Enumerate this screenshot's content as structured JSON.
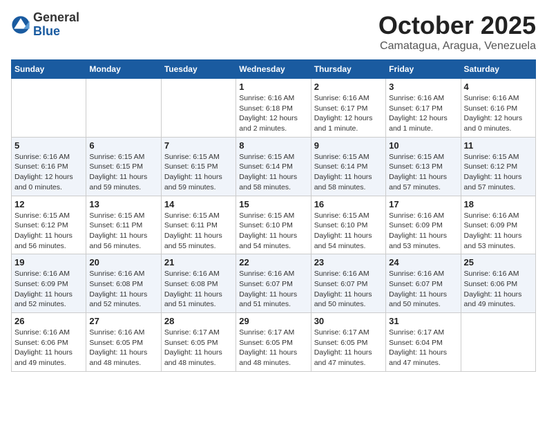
{
  "logo": {
    "general": "General",
    "blue": "Blue"
  },
  "title": "October 2025",
  "location": "Camatagua, Aragua, Venezuela",
  "days_header": [
    "Sunday",
    "Monday",
    "Tuesday",
    "Wednesday",
    "Thursday",
    "Friday",
    "Saturday"
  ],
  "weeks": [
    [
      {
        "day": "",
        "info": ""
      },
      {
        "day": "",
        "info": ""
      },
      {
        "day": "",
        "info": ""
      },
      {
        "day": "1",
        "info": "Sunrise: 6:16 AM\nSunset: 6:18 PM\nDaylight: 12 hours\nand 2 minutes."
      },
      {
        "day": "2",
        "info": "Sunrise: 6:16 AM\nSunset: 6:17 PM\nDaylight: 12 hours\nand 1 minute."
      },
      {
        "day": "3",
        "info": "Sunrise: 6:16 AM\nSunset: 6:17 PM\nDaylight: 12 hours\nand 1 minute."
      },
      {
        "day": "4",
        "info": "Sunrise: 6:16 AM\nSunset: 6:16 PM\nDaylight: 12 hours\nand 0 minutes."
      }
    ],
    [
      {
        "day": "5",
        "info": "Sunrise: 6:16 AM\nSunset: 6:16 PM\nDaylight: 12 hours\nand 0 minutes."
      },
      {
        "day": "6",
        "info": "Sunrise: 6:15 AM\nSunset: 6:15 PM\nDaylight: 11 hours\nand 59 minutes."
      },
      {
        "day": "7",
        "info": "Sunrise: 6:15 AM\nSunset: 6:15 PM\nDaylight: 11 hours\nand 59 minutes."
      },
      {
        "day": "8",
        "info": "Sunrise: 6:15 AM\nSunset: 6:14 PM\nDaylight: 11 hours\nand 58 minutes."
      },
      {
        "day": "9",
        "info": "Sunrise: 6:15 AM\nSunset: 6:14 PM\nDaylight: 11 hours\nand 58 minutes."
      },
      {
        "day": "10",
        "info": "Sunrise: 6:15 AM\nSunset: 6:13 PM\nDaylight: 11 hours\nand 57 minutes."
      },
      {
        "day": "11",
        "info": "Sunrise: 6:15 AM\nSunset: 6:12 PM\nDaylight: 11 hours\nand 57 minutes."
      }
    ],
    [
      {
        "day": "12",
        "info": "Sunrise: 6:15 AM\nSunset: 6:12 PM\nDaylight: 11 hours\nand 56 minutes."
      },
      {
        "day": "13",
        "info": "Sunrise: 6:15 AM\nSunset: 6:11 PM\nDaylight: 11 hours\nand 56 minutes."
      },
      {
        "day": "14",
        "info": "Sunrise: 6:15 AM\nSunset: 6:11 PM\nDaylight: 11 hours\nand 55 minutes."
      },
      {
        "day": "15",
        "info": "Sunrise: 6:15 AM\nSunset: 6:10 PM\nDaylight: 11 hours\nand 54 minutes."
      },
      {
        "day": "16",
        "info": "Sunrise: 6:15 AM\nSunset: 6:10 PM\nDaylight: 11 hours\nand 54 minutes."
      },
      {
        "day": "17",
        "info": "Sunrise: 6:16 AM\nSunset: 6:09 PM\nDaylight: 11 hours\nand 53 minutes."
      },
      {
        "day": "18",
        "info": "Sunrise: 6:16 AM\nSunset: 6:09 PM\nDaylight: 11 hours\nand 53 minutes."
      }
    ],
    [
      {
        "day": "19",
        "info": "Sunrise: 6:16 AM\nSunset: 6:09 PM\nDaylight: 11 hours\nand 52 minutes."
      },
      {
        "day": "20",
        "info": "Sunrise: 6:16 AM\nSunset: 6:08 PM\nDaylight: 11 hours\nand 52 minutes."
      },
      {
        "day": "21",
        "info": "Sunrise: 6:16 AM\nSunset: 6:08 PM\nDaylight: 11 hours\nand 51 minutes."
      },
      {
        "day": "22",
        "info": "Sunrise: 6:16 AM\nSunset: 6:07 PM\nDaylight: 11 hours\nand 51 minutes."
      },
      {
        "day": "23",
        "info": "Sunrise: 6:16 AM\nSunset: 6:07 PM\nDaylight: 11 hours\nand 50 minutes."
      },
      {
        "day": "24",
        "info": "Sunrise: 6:16 AM\nSunset: 6:07 PM\nDaylight: 11 hours\nand 50 minutes."
      },
      {
        "day": "25",
        "info": "Sunrise: 6:16 AM\nSunset: 6:06 PM\nDaylight: 11 hours\nand 49 minutes."
      }
    ],
    [
      {
        "day": "26",
        "info": "Sunrise: 6:16 AM\nSunset: 6:06 PM\nDaylight: 11 hours\nand 49 minutes."
      },
      {
        "day": "27",
        "info": "Sunrise: 6:16 AM\nSunset: 6:05 PM\nDaylight: 11 hours\nand 48 minutes."
      },
      {
        "day": "28",
        "info": "Sunrise: 6:17 AM\nSunset: 6:05 PM\nDaylight: 11 hours\nand 48 minutes."
      },
      {
        "day": "29",
        "info": "Sunrise: 6:17 AM\nSunset: 6:05 PM\nDaylight: 11 hours\nand 48 minutes."
      },
      {
        "day": "30",
        "info": "Sunrise: 6:17 AM\nSunset: 6:05 PM\nDaylight: 11 hours\nand 47 minutes."
      },
      {
        "day": "31",
        "info": "Sunrise: 6:17 AM\nSunset: 6:04 PM\nDaylight: 11 hours\nand 47 minutes."
      },
      {
        "day": "",
        "info": ""
      }
    ]
  ],
  "row_shading": [
    false,
    true,
    false,
    true,
    false
  ]
}
